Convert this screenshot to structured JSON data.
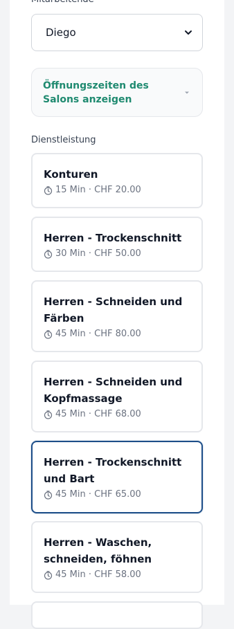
{
  "staff": {
    "label": "Mitarbeitende",
    "selected": "Diego"
  },
  "hours_toggle": {
    "label": "Öffnungszeiten des Salons anzeigen"
  },
  "services": {
    "label": "Dienstleistung",
    "items": [
      {
        "name": "Konturen",
        "meta": "15 Min · CHF 20.00",
        "selected": false
      },
      {
        "name": "Herren - Trockenschnitt",
        "meta": "30 Min · CHF 50.00",
        "selected": false
      },
      {
        "name": "Herren - Schneiden und Färben",
        "meta": "45 Min · CHF 80.00",
        "selected": false
      },
      {
        "name": "Herren - Schneiden und Kopfmassage",
        "meta": "45 Min · CHF 68.00",
        "selected": false
      },
      {
        "name": "Herren - Trockenschnitt und Bart",
        "meta": "45 Min · CHF 65.00",
        "selected": true
      },
      {
        "name": "Herren - Waschen, schneiden, föhnen",
        "meta": "45 Min · CHF 58.00",
        "selected": false
      }
    ]
  },
  "colors": {
    "accent_green": "#1f8a70",
    "selected_border": "#1d4e89",
    "card_border": "#e5e7eb"
  },
  "icons": {
    "select_chevron": "chevron-down-icon",
    "hours_caret": "caret-down-icon",
    "duration": "clock-icon"
  }
}
